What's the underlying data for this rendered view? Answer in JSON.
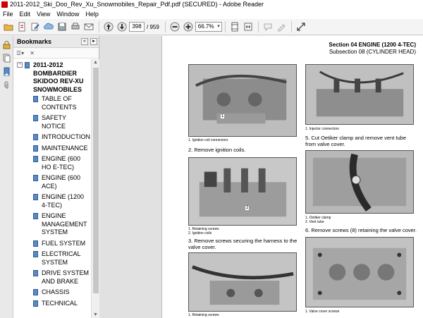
{
  "window": {
    "title": "2011-2012_Ski_Doo_Rev_Xu_Snowmobiles_Repair_Pdf.pdf (SECURED) - Adobe Reader"
  },
  "menu": [
    "File",
    "Edit",
    "View",
    "Window",
    "Help"
  ],
  "toolbar": {
    "current_page": "398",
    "total_pages": "/ 959",
    "zoom": "66.7%"
  },
  "bookmarks": {
    "header": "Bookmarks",
    "root": "2011-2012 BOMBARDIER SKIDOO REV-XU SNOWMOBILES",
    "items": [
      "TABLE OF CONTENTS",
      "SAFETY NOTICE",
      "INTRODUCTION",
      "MAINTENANCE",
      "ENGINE (600 HO E-TEC)",
      "ENGINE (600 ACE)",
      "ENGINE (1200 4-TEC)",
      "ENGINE MANAGEMENT SYSTEM",
      "FUEL SYSTEM",
      "ELECTRICAL SYSTEM",
      "DRIVE SYSTEM AND BRAKE",
      "CHASSIS",
      "TECHNICAL"
    ]
  },
  "document": {
    "section": "Section 04   ENGINE (1200 4-TEC)",
    "subsection": "Subsection 08   (CYLINDER HEAD)",
    "left": {
      "fig1_caption": "1.  Ignition coil connectors",
      "step2": "2.  Remove ignition coils.",
      "fig2_caption1": "1.  Retaining screws",
      "fig2_caption2": "2.  Ignition coils",
      "step3": "3.  Remove screws securing the harness to the valve cover.",
      "fig3_caption": "1.  Retaining screws"
    },
    "right": {
      "fig1_caption": "1.  Injector connectors",
      "step5": "5.  Cut Oetiker clamp and remove vent tube from valve cover.",
      "fig2_caption1": "1.  Oetiker clamp",
      "fig2_caption2": "2.  Vent tube",
      "step6": "6.  Remove screws (8) retaining the valve cover.",
      "fig3_caption": "1.  Valve cover screws"
    },
    "callouts": [
      "1",
      "2"
    ]
  }
}
